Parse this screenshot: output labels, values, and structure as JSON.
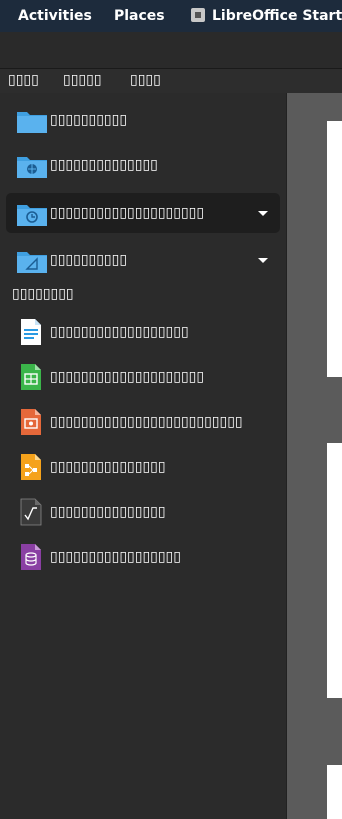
{
  "topbar": {
    "activities": "Activities",
    "places": "Places",
    "app_title": "LibreOffice Start C"
  },
  "menu": [
    "▯▯▯▯",
    "▯▯▯▯▯",
    "▯▯▯▯"
  ],
  "locations": [
    {
      "label": "▯▯▯▯▯▯▯▯▯▯",
      "icon": "folder-icon"
    },
    {
      "label": "▯▯▯▯▯▯▯▯▯▯▯▯▯▯",
      "icon": "remote-folder-icon"
    },
    {
      "label": "▯▯▯▯▯▯▯▯▯▯▯▯▯▯▯▯▯▯▯▯",
      "icon": "recent-folder-icon"
    },
    {
      "label": "▯▯▯▯▯▯▯▯▯▯",
      "icon": "template-folder-icon"
    }
  ],
  "create_section": "▯▯▯▯▯▯▯▯",
  "create_items": [
    {
      "label": "▯▯▯▯▯▯▯▯▯▯▯▯▯▯▯▯▯▯",
      "icon": "writer-document-icon",
      "color": "#2a9ae3"
    },
    {
      "label": "▯▯▯▯▯▯▯▯▯▯▯▯▯▯▯▯▯▯▯▯",
      "icon": "calc-spreadsheet-icon",
      "color": "#3bb54a"
    },
    {
      "label": "▯▯▯▯▯▯▯▯▯▯▯▯▯▯▯▯▯▯▯▯▯▯▯▯▯",
      "icon": "impress-presentation-icon",
      "color": "#e5683a"
    },
    {
      "label": "▯▯▯▯▯▯▯▯▯▯▯▯▯▯▯",
      "icon": "draw-drawing-icon",
      "color": "#f5a21b"
    },
    {
      "label": "▯▯▯▯▯▯▯▯▯▯▯▯▯▯▯",
      "icon": "math-formula-icon",
      "color": "#3a3a3a"
    },
    {
      "label": "▯▯▯▯▯▯▯▯▯▯▯▯▯▯▯▯▯",
      "icon": "base-database-icon",
      "color": "#8a3fa3"
    }
  ],
  "colors": {
    "topbar_bg": "#1d2b3c",
    "sidebar_bg": "#2b2b2b",
    "folder_blue": "#3f9fe0",
    "preview_bg": "#5b5b5b"
  }
}
